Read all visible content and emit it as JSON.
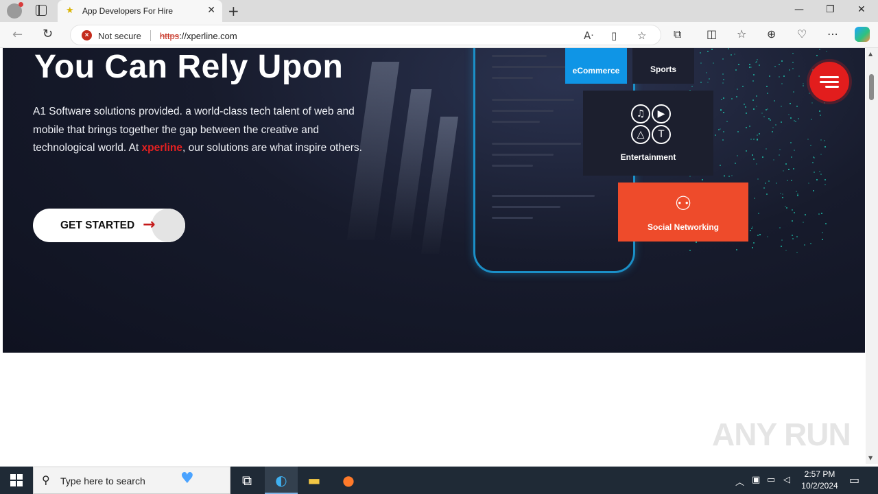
{
  "browser": {
    "tab": {
      "title": "App Developers For Hire",
      "favicon": "star-favicon-icon"
    },
    "security": {
      "label": "Not secure",
      "color": "#c42b1c"
    },
    "url": {
      "scheme": "https",
      "rest": "://xperline.com"
    }
  },
  "hero": {
    "title": "You Can Rely Upon",
    "desc_before": "A1 Software solutions provided. a world-class tech talent of web and mobile that brings together the gap between the creative and technological world. At ",
    "brand": "xperline",
    "desc_after": ", our solutions are what inspire others.",
    "cta_label": "GET STARTED",
    "brand_color": "#e52121"
  },
  "tiles": {
    "ecommerce": "eCommerce",
    "sports": "Sports",
    "entertainment": "Entertainment",
    "social": "Social Networking"
  },
  "watermark": "ANY RUN",
  "taskbar": {
    "search_placeholder": "Type here to search",
    "time": "2:57 PM",
    "date": "10/2/2024"
  }
}
